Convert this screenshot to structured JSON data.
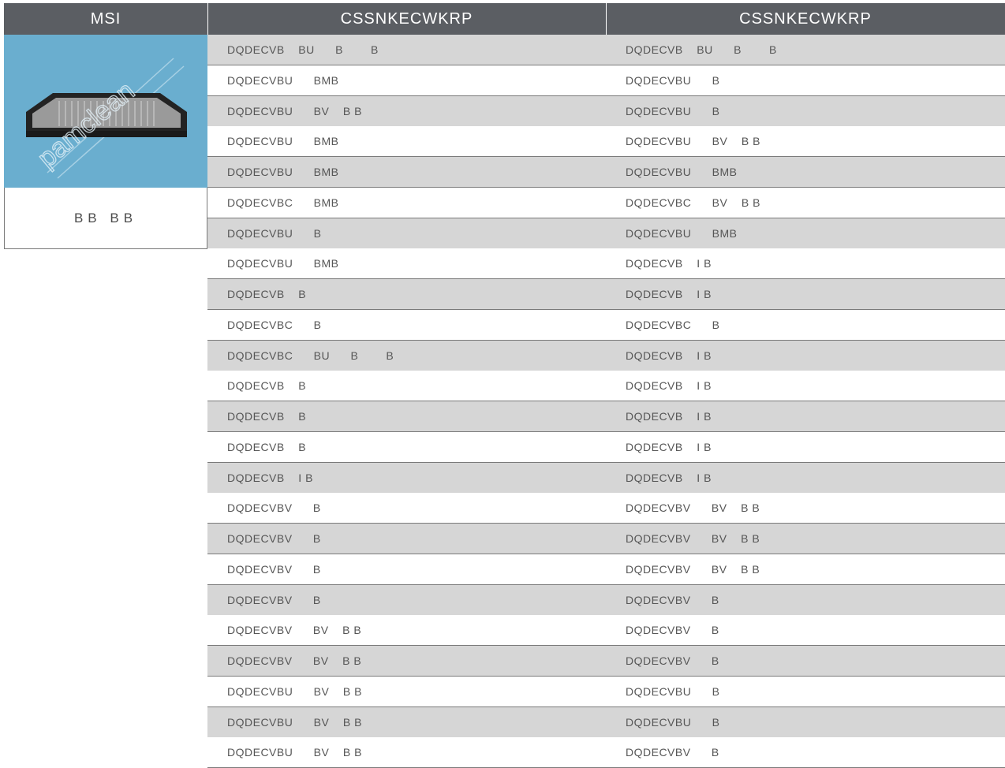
{
  "header": {
    "col1": "MSI",
    "col2": "CSSNKECWKRP",
    "col3": "CSSNKECWKRP"
  },
  "product": {
    "image_watermark": "pamclean",
    "code": "BB   BB"
  },
  "rows": [
    {
      "left": "DQDECVB    BU      B        B",
      "right": "DQDECVB    BU      B        B"
    },
    {
      "left": "DQDECVBU      BMB",
      "right": "DQDECVBU      B"
    },
    {
      "left": "DQDECVBU      BV    B B",
      "right": "DQDECVBU      B"
    },
    {
      "left": "DQDECVBU      BMB",
      "right": "DQDECVBU      BV    B B"
    },
    {
      "left": "DQDECVBU      BMB",
      "right": "DQDECVBU      BMB"
    },
    {
      "left": "DQDECVBC      BMB",
      "right": "DQDECVBC      BV    B B"
    },
    {
      "left": "DQDECVBU      B",
      "right": "DQDECVBU      BMB"
    },
    {
      "left": "DQDECVBU      BMB",
      "right": "DQDECVB    I B"
    },
    {
      "left": "DQDECVB    B",
      "right": "DQDECVB    I B"
    },
    {
      "left": "DQDECVBC      B",
      "right": "DQDECVBC      B"
    },
    {
      "left": "DQDECVBC      BU      B        B",
      "right": "DQDECVB    I B"
    },
    {
      "left": "DQDECVB    B",
      "right": "DQDECVB    I B"
    },
    {
      "left": "DQDECVB    B",
      "right": "DQDECVB    I B"
    },
    {
      "left": "DQDECVB    B",
      "right": "DQDECVB    I B"
    },
    {
      "left": "DQDECVB    I B",
      "right": "DQDECVB    I B"
    },
    {
      "left": "DQDECVBV      B",
      "right": "DQDECVBV      BV    B B"
    },
    {
      "left": "DQDECVBV      B",
      "right": "DQDECVBV      BV    B B"
    },
    {
      "left": "DQDECVBV      B",
      "right": "DQDECVBV      BV    B B"
    },
    {
      "left": "DQDECVBV      B",
      "right": "DQDECVBV      B"
    },
    {
      "left": "DQDECVBV      BV    B B",
      "right": "DQDECVBV      B"
    },
    {
      "left": "DQDECVBV      BV    B B",
      "right": "DQDECVBV      B"
    },
    {
      "left": "DQDECVBU      BV    B B",
      "right": "DQDECVBU      B"
    },
    {
      "left": "DQDECVBU      BV    B B",
      "right": "DQDECVBU      B"
    },
    {
      "left": "DQDECVBU      BV    B B",
      "right": "DQDECVBV      B"
    }
  ]
}
